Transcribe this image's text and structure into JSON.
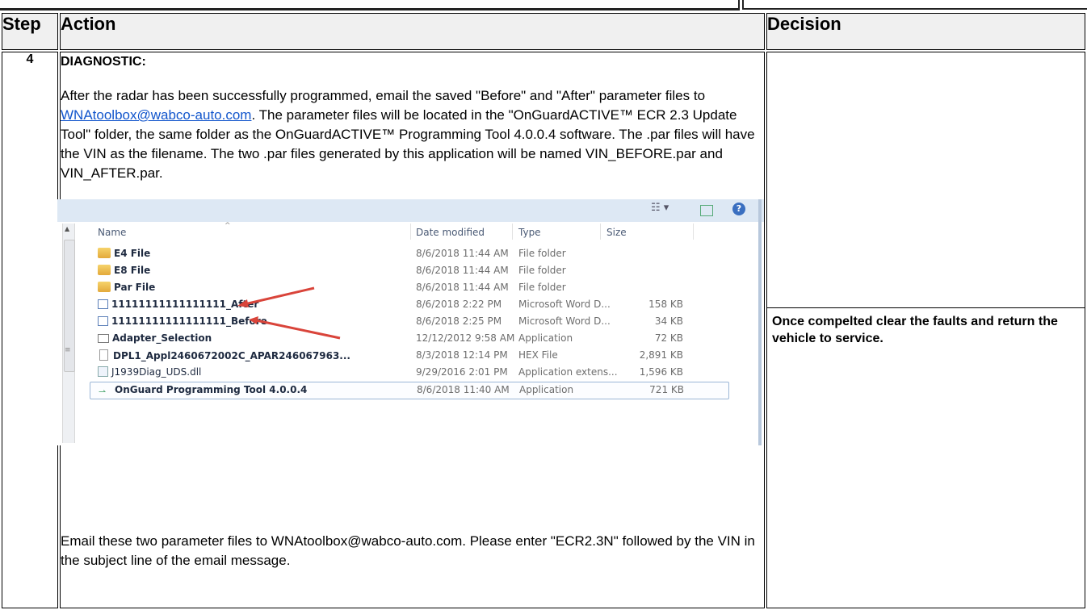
{
  "table": {
    "headers": {
      "step": "Step",
      "action": "Action",
      "decision": "Decision"
    },
    "row": {
      "step": "4",
      "diagnostic_label": "DIAGNOSTIC:",
      "para1_a": "After the radar has been successfully programmed, email the saved \"Before\" and \"After\" parameter files to ",
      "para1_link": "WNAtoolbox@wabco-auto.com",
      "para1_b": ". The parameter files will be located in the \"OnGuardACTIVE™ ECR 2.3 Update Tool\" folder, the same folder as the OnGuardACTIVE™ Programming Tool 4.0.0.4 software. The .par files will have the VIN as the filename. The two .par files generated by this application will be named VIN_BEFORE.par and VIN_AFTER.par.",
      "para2": "Email these two parameter files to WNAtoolbox@wabco-auto.com. Please enter \"ECR2.3N\" followed by the VIN in the subject line of the email message.",
      "decision": "Once compelted clear the faults and return the vehicle to service."
    }
  },
  "explorer": {
    "columns": {
      "name": "Name",
      "date": "Date modified",
      "type": "Type",
      "size": "Size"
    },
    "files": [
      {
        "icon": "folder-icon",
        "name": "E4 File",
        "date": "8/6/2018 11:44 AM",
        "type": "File folder",
        "size": ""
      },
      {
        "icon": "folder-icon",
        "name": "E8 File",
        "date": "8/6/2018 11:44 AM",
        "type": "File folder",
        "size": ""
      },
      {
        "icon": "folder-icon",
        "name": "Par File",
        "date": "8/6/2018 11:44 AM",
        "type": "File folder",
        "size": ""
      },
      {
        "icon": "word-doc-icon",
        "name": "11111111111111111_After",
        "date": "8/6/2018 2:22 PM",
        "type": "Microsoft Word D...",
        "size": "158 KB"
      },
      {
        "icon": "word-doc-icon",
        "name": "11111111111111111_Before",
        "date": "8/6/2018 2:25 PM",
        "type": "Microsoft Word D...",
        "size": "34 KB"
      },
      {
        "icon": "application-icon",
        "name": "Adapter_Selection",
        "date": "12/12/2012 9:58 AM",
        "type": "Application",
        "size": "72 KB"
      },
      {
        "icon": "hex-file-icon",
        "name": "DPL1_Appl2460672002C_APAR246067963...",
        "date": "8/3/2018 12:14 PM",
        "type": "HEX File",
        "size": "2,891 KB"
      },
      {
        "icon": "dll-icon",
        "name": "J1939Diag_UDS.dll",
        "date": "9/29/2016 2:01 PM",
        "type": "Application extens...",
        "size": "1,596 KB"
      },
      {
        "icon": "program-icon",
        "name": "OnGuard Programming Tool 4.0.0.4",
        "date": "8/6/2018 11:40 AM",
        "type": "Application",
        "size": "721 KB"
      }
    ],
    "accent_arrow": "#d9443a"
  }
}
